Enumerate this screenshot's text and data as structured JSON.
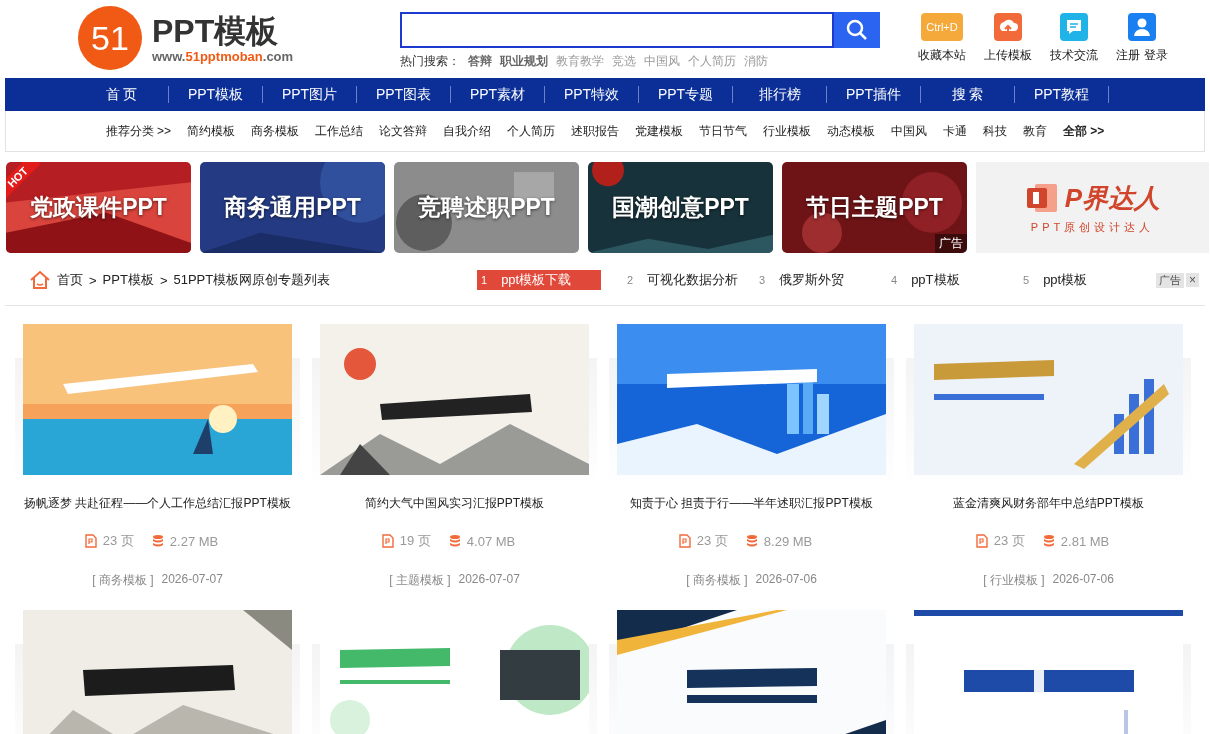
{
  "header": {
    "logo_mark": "51",
    "logo_title": "PPT模板",
    "logo_url_prefix": "www.",
    "logo_url_accent": "51pptmoban",
    "logo_url_suffix": ".com",
    "search": {
      "hot_label": "热门搜索：",
      "hot_items": [
        {
          "text": "答辩",
          "emphasized": true
        },
        {
          "text": "职业规划",
          "emphasized": true
        },
        {
          "text": "教育教学",
          "emphasized": false
        },
        {
          "text": "竞选",
          "emphasized": false
        },
        {
          "text": "中国风",
          "emphasized": false
        },
        {
          "text": "个人简历",
          "emphasized": false
        },
        {
          "text": "消防",
          "emphasized": false
        }
      ]
    },
    "actions": [
      {
        "kind": "bookmark",
        "label": "收藏本站",
        "icon_text": "Ctrl+D"
      },
      {
        "kind": "upload",
        "label": "上传模板"
      },
      {
        "kind": "chat",
        "label": "技术交流"
      },
      {
        "kind": "user",
        "links": [
          "注册",
          "登录"
        ]
      }
    ]
  },
  "nav": [
    "首 页",
    "PPT模板",
    "PPT图片",
    "PPT图表",
    "PPT素材",
    "PPT特效",
    "PPT专题",
    "排行榜",
    "PPT插件",
    "搜 索",
    "PPT教程"
  ],
  "categories": {
    "lead": "推荐分类 >>",
    "items": [
      "简约模板",
      "商务模板",
      "工作总结",
      "论文答辩",
      "自我介绍",
      "个人简历",
      "述职报告",
      "党建模板",
      "节日节气",
      "行业模板",
      "动态模板",
      "中国风",
      "卡通",
      "科技",
      "教育"
    ],
    "all": "全部 >>"
  },
  "banners": [
    {
      "kind": "picture",
      "title": "党政课件PPT",
      "badge": "HOT"
    },
    {
      "kind": "picture",
      "title": "商务通用PPT"
    },
    {
      "kind": "picture",
      "title": "竞聘述职PPT"
    },
    {
      "kind": "picture",
      "title": "国潮创意PPT"
    },
    {
      "kind": "picture",
      "title": "节日主题PPT",
      "ad_label": "广告"
    },
    {
      "kind": "logo",
      "title": "P界达人",
      "subtitle": "PPT原创设计达人"
    }
  ],
  "breadcrumb": [
    "首页",
    "PPT模板",
    "51PPT模板网原创专题列表"
  ],
  "breadcrumb_separator": ">",
  "ticker": {
    "items": [
      {
        "rank": "1",
        "text": "ppt模板下载",
        "selected": true
      },
      {
        "rank": "2",
        "text": "可视化数据分析",
        "selected": false
      },
      {
        "rank": "3",
        "text": "俄罗斯外贸",
        "selected": false
      },
      {
        "rank": "4",
        "text": "ppT模板",
        "selected": false
      },
      {
        "rank": "5",
        "text": "ppt模板",
        "selected": false
      }
    ],
    "ad_label": "广告",
    "close": "×"
  },
  "cards": [
    {
      "title": "扬帆逐梦 共赴征程——个人工作总结汇报PPT模板",
      "pages": "23 页",
      "size": "2.27 MB",
      "category": "[ 商务模板 ]",
      "date": "2026-07-07"
    },
    {
      "title": "简约大气中国风实习汇报PPT模板",
      "pages": "19 页",
      "size": "4.07 MB",
      "category": "[ 主题模板 ]",
      "date": "2026-07-07"
    },
    {
      "title": "知责于心 担责于行——半年述职汇报PPT模板",
      "pages": "23 页",
      "size": "8.29 MB",
      "category": "[ 商务模板 ]",
      "date": "2026-07-06"
    },
    {
      "title": "蓝金清爽风财务部年中总结PPT模板",
      "pages": "23 页",
      "size": "2.81 MB",
      "category": "[ 行业模板 ]",
      "date": "2026-07-06"
    }
  ],
  "more_cards": [
    {
      "kind": "picture"
    },
    {
      "kind": "picture"
    },
    {
      "kind": "picture"
    },
    {
      "kind": "picture"
    }
  ]
}
